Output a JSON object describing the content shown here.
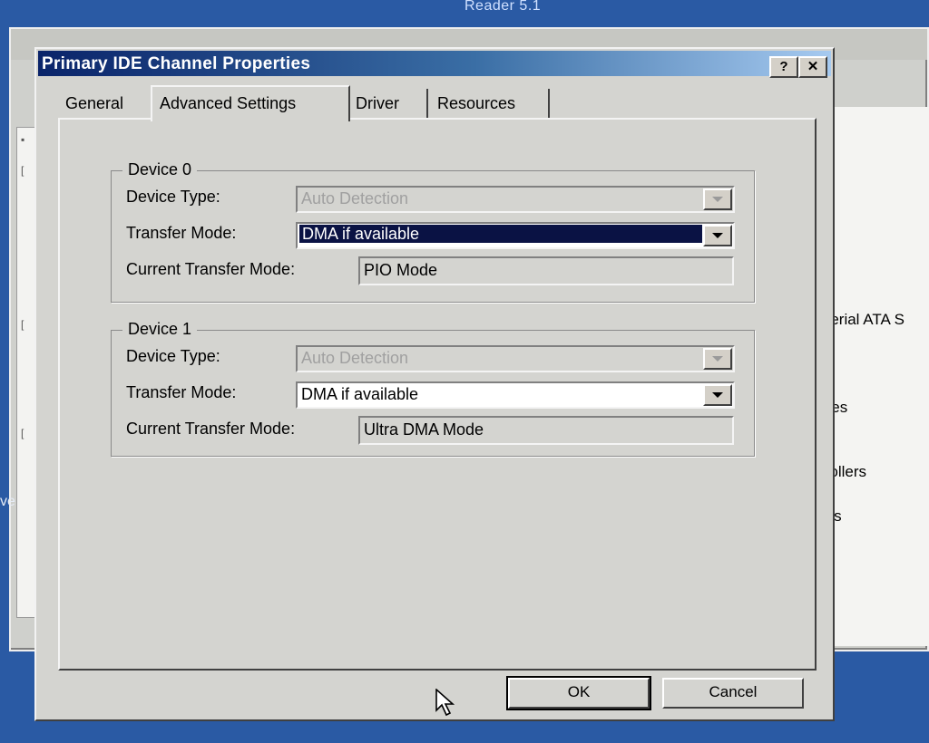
{
  "desktop": {
    "top_title": "Reader 5.1"
  },
  "background_window": {
    "list_items": [
      "Serial ATA S",
      "ices",
      "trollers",
      "ers"
    ],
    "side_cut_text": "ve"
  },
  "dialog": {
    "title": "Primary IDE Channel Properties",
    "help_button": "?",
    "close_button": "✕",
    "tabs": [
      {
        "label": "General"
      },
      {
        "label": "Advanced Settings"
      },
      {
        "label": "Driver"
      },
      {
        "label": "Resources"
      }
    ],
    "active_tab": "Advanced Settings",
    "labels": {
      "device_type": "Device Type:",
      "transfer_mode": "Transfer Mode:",
      "current_transfer_mode": "Current Transfer Mode:"
    },
    "devices": [
      {
        "name": "Device 0",
        "device_type": "Auto Detection",
        "transfer_mode": "DMA if available",
        "current_transfer_mode": "PIO Mode"
      },
      {
        "name": "Device 1",
        "device_type": "Auto Detection",
        "transfer_mode": "DMA if available",
        "current_transfer_mode": "Ultra DMA Mode"
      }
    ],
    "buttons": {
      "ok": "OK",
      "cancel": "Cancel"
    }
  },
  "colors": {
    "desktop": "#2a5aa4",
    "titlebar": "#0a246a",
    "selection": "#0a1244",
    "face": "#d4d4d0"
  }
}
